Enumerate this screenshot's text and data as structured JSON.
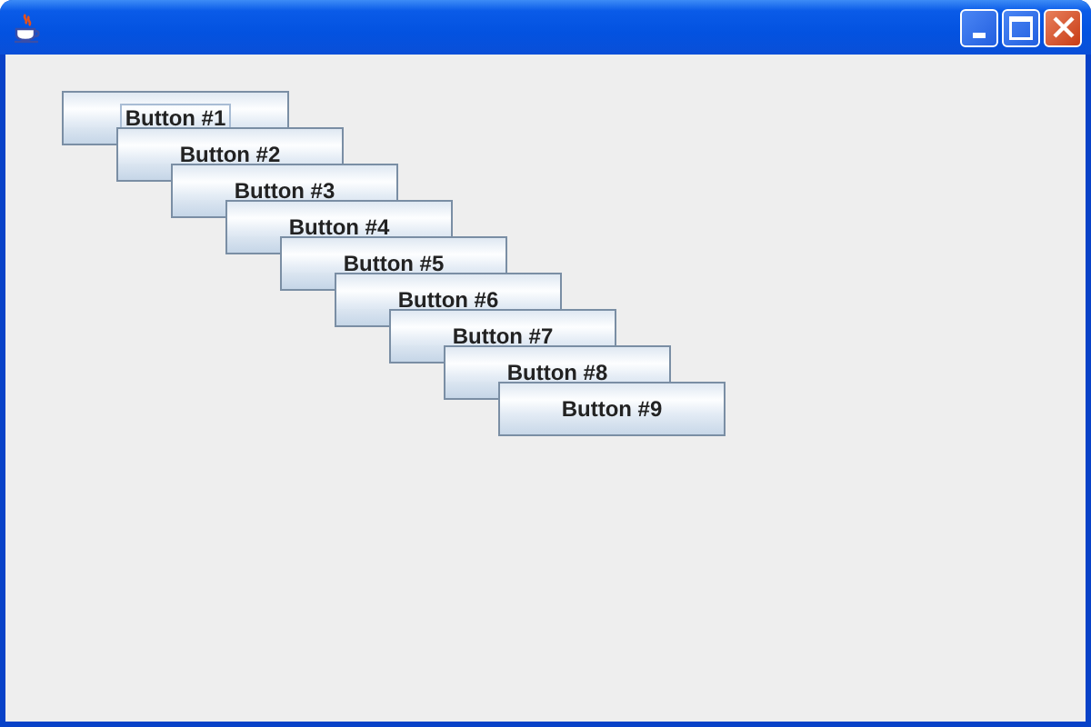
{
  "buttons": [
    {
      "label": "Button #1",
      "focused": true
    },
    {
      "label": "Button #2",
      "focused": false
    },
    {
      "label": "Button #3",
      "focused": false
    },
    {
      "label": "Button #4",
      "focused": false
    },
    {
      "label": "Button #5",
      "focused": false
    },
    {
      "label": "Button #6",
      "focused": false
    },
    {
      "label": "Button #7",
      "focused": false
    },
    {
      "label": "Button #8",
      "focused": false
    },
    {
      "label": "Button #9",
      "focused": false
    }
  ]
}
